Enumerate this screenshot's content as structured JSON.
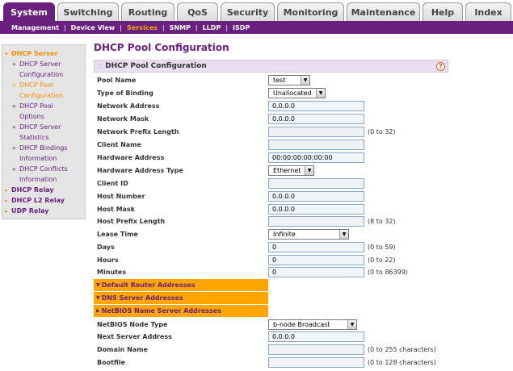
{
  "tabs": [
    {
      "label": "System",
      "active": true
    },
    {
      "label": "Switching"
    },
    {
      "label": "Routing"
    },
    {
      "label": "QoS"
    },
    {
      "label": "Security"
    },
    {
      "label": "Monitoring"
    },
    {
      "label": "Maintenance"
    },
    {
      "label": "Help"
    },
    {
      "label": "Index"
    }
  ],
  "subnav": [
    "Management",
    "Device View",
    "Services",
    "SNMP",
    "LLDP",
    "ISDP"
  ],
  "subnav_active": "Services",
  "sidebar": {
    "dhcp_server": "DHCP Server",
    "items": [
      {
        "label1": "DHCP Server",
        "label2": "Configuration"
      },
      {
        "label1": "DHCP Pool",
        "label2": "Configuration"
      },
      {
        "label1": "DHCP Pool",
        "label2": "Options"
      },
      {
        "label1": "DHCP Server",
        "label2": "Statistics"
      },
      {
        "label1": "DHCP Bindings",
        "label2": "Information"
      },
      {
        "label1": "DHCP Conflicts",
        "label2": "Information"
      }
    ],
    "dhcp_relay": "DHCP Relay",
    "dhcp_l2_relay": "DHCP L2 Relay",
    "udp_relay": "UDP Relay"
  },
  "page_title": "DHCP Pool Configuration",
  "section_title": "DHCP Pool Configuration",
  "help_glyph": "?",
  "form": {
    "pool_name": {
      "label": "Pool Name",
      "value": "test"
    },
    "type_of_binding": {
      "label": "Type of Binding",
      "value": "Unallocated"
    },
    "network_address": {
      "label": "Network Address",
      "value": "0.0.0.0"
    },
    "network_mask": {
      "label": "Network Mask",
      "value": "0.0.0.0"
    },
    "network_prefix_length": {
      "label": "Network Prefix Length",
      "value": "",
      "hint": "(0 to 32)"
    },
    "client_name": {
      "label": "Client Name",
      "value": ""
    },
    "hardware_address": {
      "label": "Hardware Address",
      "value": "00:00:00:00:00:00"
    },
    "hardware_address_type": {
      "label": "Hardware Address Type",
      "value": "Ethernet"
    },
    "client_id": {
      "label": "Client ID",
      "value": ""
    },
    "host_number": {
      "label": "Host Number",
      "value": "0.0.0.0"
    },
    "host_mask": {
      "label": "Host Mask",
      "value": "0.0.0.0"
    },
    "host_prefix_length": {
      "label": "Host Prefix Length",
      "value": "",
      "hint": "(8 to 32)"
    },
    "lease_time": {
      "label": "Lease Time",
      "value": "Infinite"
    },
    "days": {
      "label": "Days",
      "value": "0",
      "hint": "(0 to 59)"
    },
    "hours": {
      "label": "Hours",
      "value": "0",
      "hint": "(0 to 22)"
    },
    "minutes": {
      "label": "Minutes",
      "value": "0",
      "hint": "(0 to 86399)"
    },
    "default_router": "Default Router Addresses",
    "dns_server": "DNS Server Addresses",
    "netbios_server": "NetBIOS Name Server Addresses",
    "netbios_node_type": {
      "label": "NetBIOS Node Type",
      "value": "b-node Broadcast"
    },
    "next_server_address": {
      "label": "Next Server Address",
      "value": "0.0.0.0"
    },
    "domain_name": {
      "label": "Domain Name",
      "value": "",
      "hint": "(0 to 255 characters)"
    },
    "bootfile": {
      "label": "Bootfile",
      "value": "",
      "hint": "(0 to 128 characters)"
    }
  },
  "colors": {
    "brand": "#6a207f",
    "accent": "#ffa500"
  }
}
